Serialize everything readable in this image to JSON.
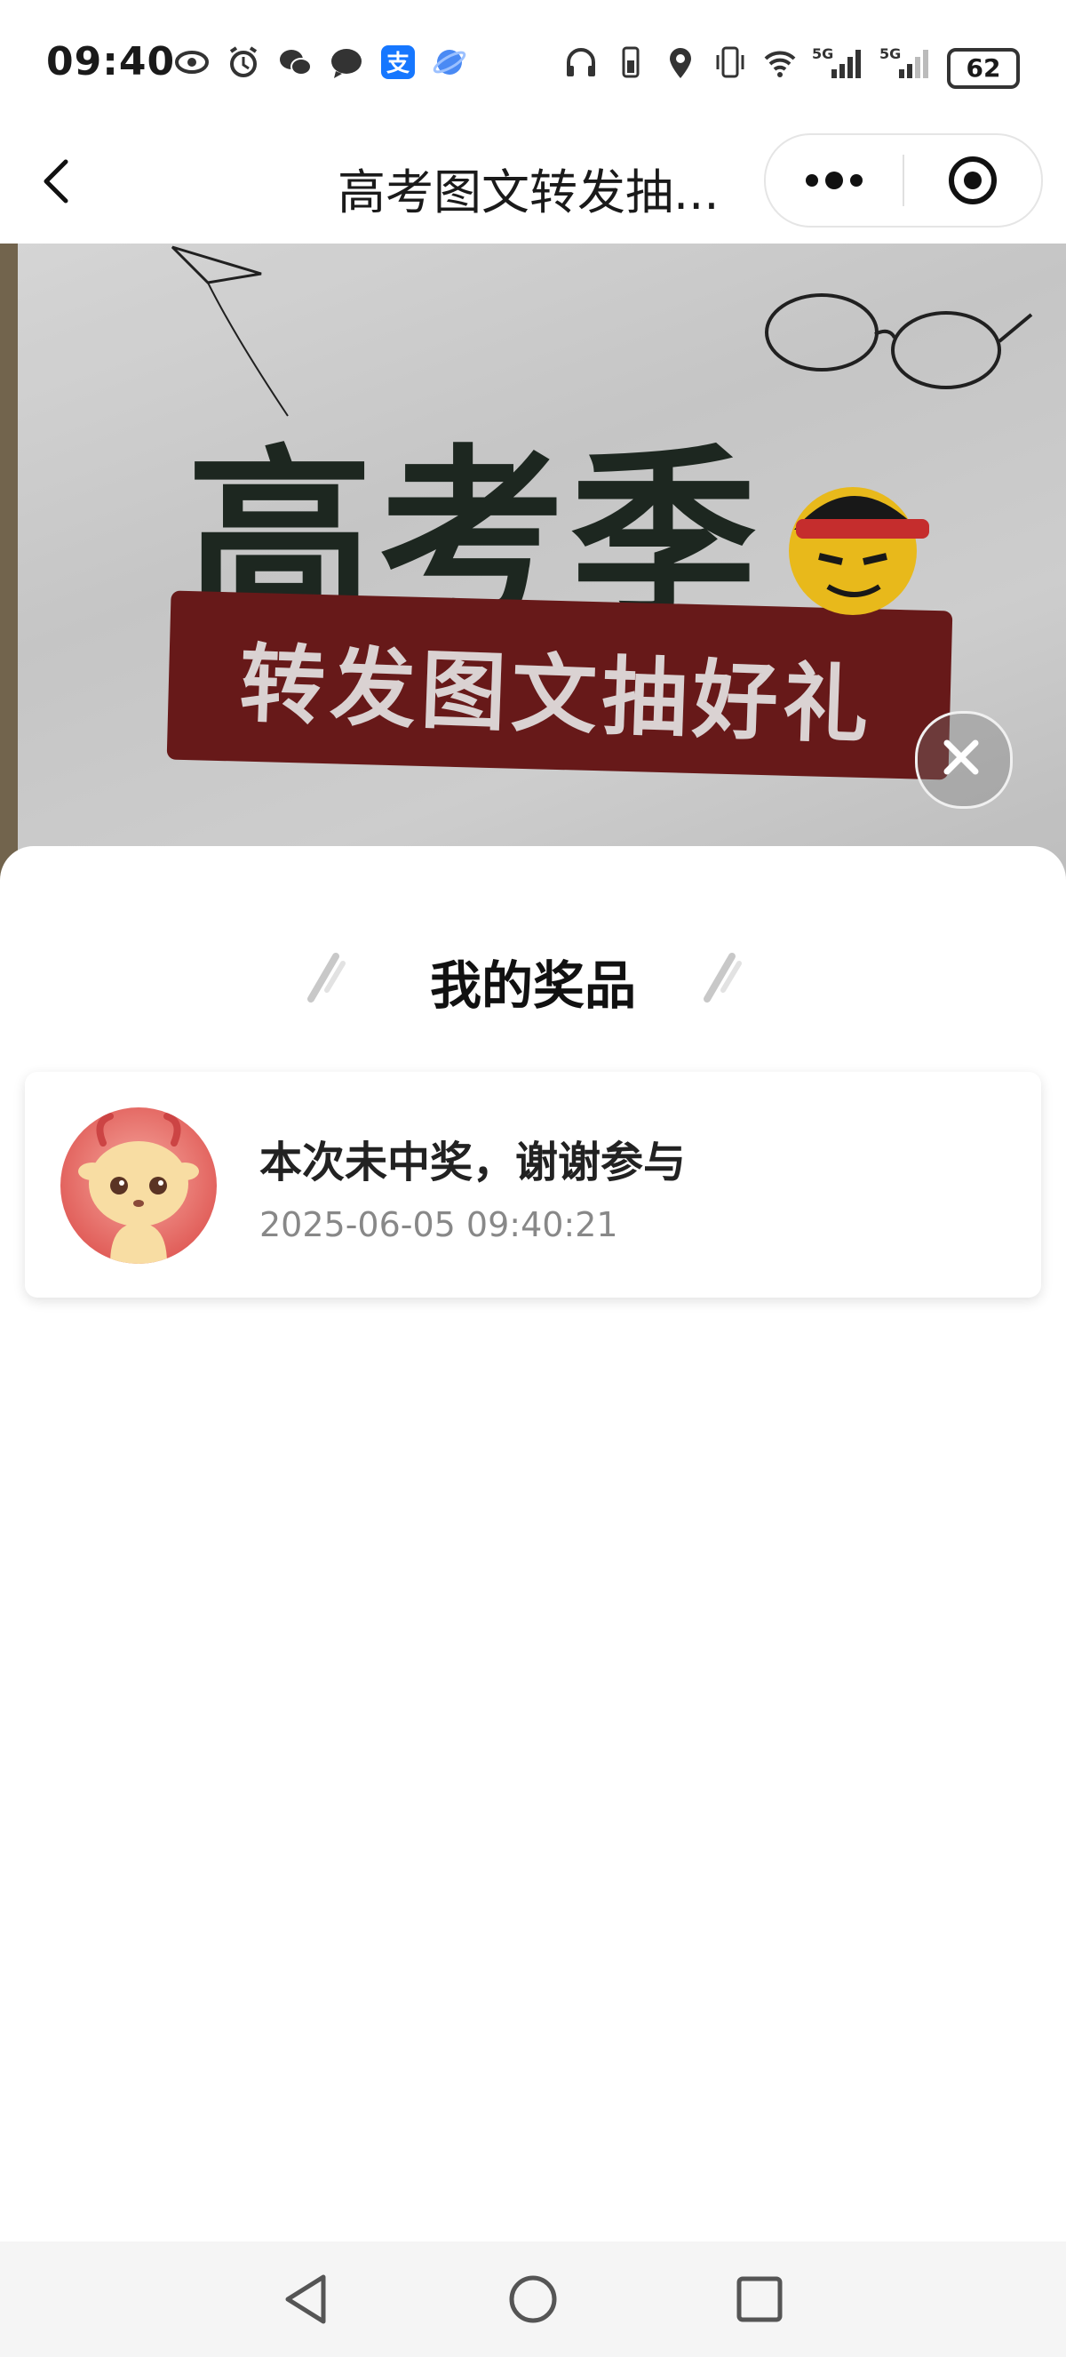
{
  "status_bar": {
    "time": "09:40",
    "left_icons": [
      "eye-icon",
      "alarm-icon",
      "wechat-icon",
      "chat-bubble-icon",
      "alipay-icon",
      "browser-icon"
    ],
    "right_icons": [
      "headphones-icon",
      "phone-battery-icon",
      "location-icon",
      "vibrate-icon",
      "wifi-icon",
      "5g-signal-icon",
      "5g-signal-icon"
    ],
    "battery": "62"
  },
  "navbar": {
    "title": "高考图文转发抽...",
    "back_icon": "chevron-left-icon",
    "more_icon": "more-dots-icon",
    "target_icon": "target-icon"
  },
  "banner": {
    "heading": "高考季",
    "subheading": "转发图文抽好礼"
  },
  "sheet": {
    "title": "我的奖品",
    "prizes": [
      {
        "name": "本次未中奖，谢谢参与",
        "time": "2025-06-05 09:40:21"
      }
    ]
  },
  "colors": {
    "banner_strip": "#6e1b1b",
    "avatar_bg": "#d9423f",
    "title_text": "#1a1a1a",
    "muted_text": "#888888"
  },
  "system_nav": {
    "icons": [
      "back-triangle-icon",
      "home-circle-icon",
      "recent-square-icon"
    ]
  }
}
